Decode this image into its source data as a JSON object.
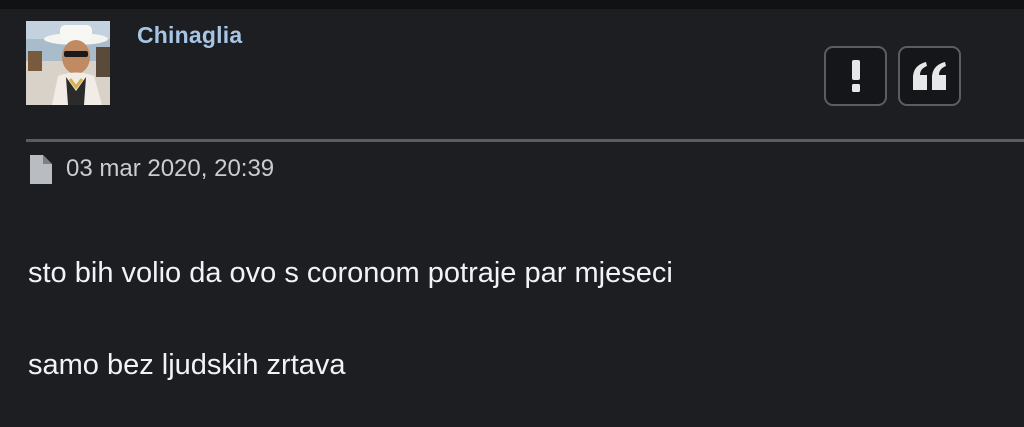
{
  "post": {
    "username": "Chinaglia",
    "date": "03 mar 2020, 20:39",
    "lines": [
      "sto bih volio da ovo s coronom potraje par mjeseci",
      "samo bez ljudskih zrtava"
    ],
    "actions": {
      "report_symbol": "!",
      "quote_symbol": "quote-icon"
    }
  },
  "colors": {
    "background": "#1c1e21",
    "username": "#a7c6e6",
    "text": "#f2f3f5",
    "button_border": "#5a5e64"
  }
}
